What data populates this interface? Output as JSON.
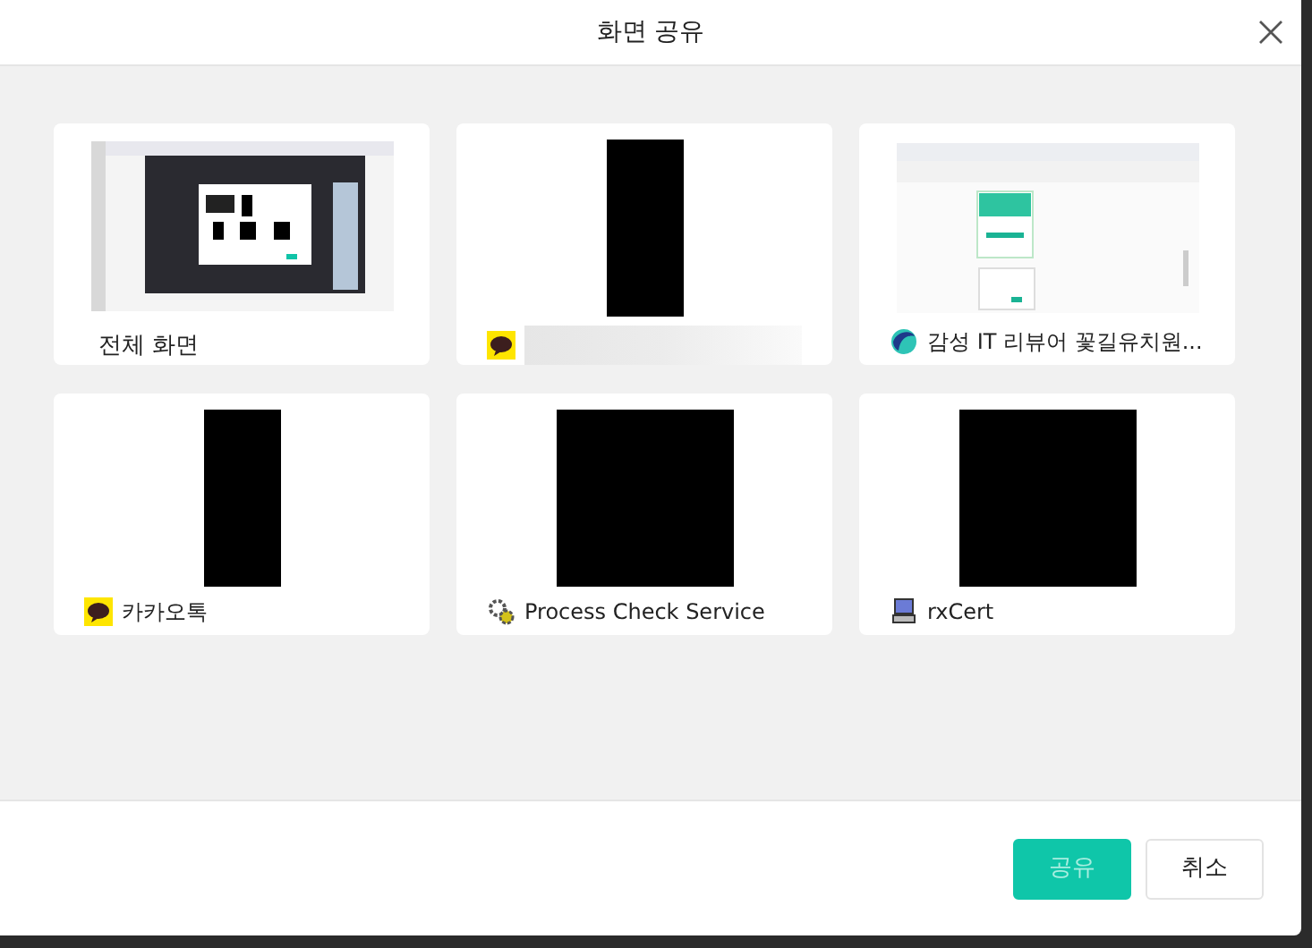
{
  "dialog": {
    "title": "화면 공유"
  },
  "sources": [
    {
      "kind": "screen",
      "title": "전체 화면"
    },
    {
      "kind": "window"
    },
    {
      "kind": "window",
      "title": "감성 IT 리뷰어 꽃길유치원..."
    },
    {
      "kind": "window",
      "title": "카카오톡"
    },
    {
      "kind": "window",
      "title": "Process Check Service"
    },
    {
      "kind": "window",
      "title": "rxCert"
    }
  ],
  "buttons": [
    {
      "label": "공유",
      "kind": "primary",
      "disabled": true
    },
    {
      "label": "취소",
      "kind": "secondary",
      "disabled": false
    }
  ]
}
